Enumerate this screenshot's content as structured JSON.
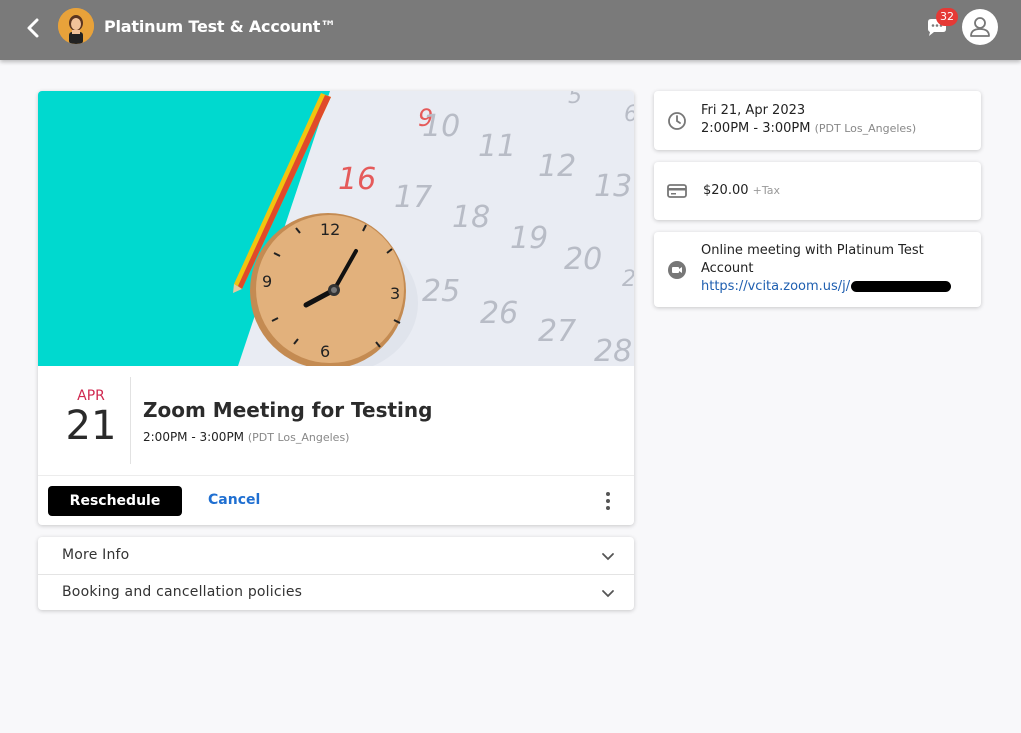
{
  "header": {
    "account_name": "Platinum Test & Account™",
    "chat_badge_count": "32",
    "icons": [
      "back-arrow-icon",
      "account-avatar",
      "chat-icon",
      "user-icon"
    ]
  },
  "event": {
    "month": "APR",
    "day": "21",
    "title": "Zoom Meeting for Testing",
    "time": "2:00PM - 3:00PM",
    "timezone": "(PDT Los_Angeles)"
  },
  "hero_image": {
    "calendar_numbers": [
      "9",
      "10",
      "11",
      "12",
      "13",
      "16",
      "17",
      "18",
      "19",
      "20",
      "25",
      "26",
      "27",
      "28",
      "5",
      "6",
      "2"
    ],
    "clock_numbers": [
      "12",
      "3",
      "6",
      "9"
    ]
  },
  "actions": {
    "reschedule_label": "Reschedule",
    "cancel_label": "Cancel"
  },
  "accordion": {
    "items": [
      {
        "label": "More Info"
      },
      {
        "label": "Booking and cancellation policies"
      }
    ]
  },
  "details": {
    "date": "Fri 21, Apr 2023",
    "time": "2:00PM - 3:00PM",
    "timezone": "(PDT Los_Angeles)",
    "price": "$20.00",
    "tax": "+Tax",
    "meeting_line1": "Online meeting with Platinum Test Account",
    "meeting_link": "https://vcita.zoom.us/j/"
  },
  "colors": {
    "topbar": "#7a7a7a",
    "accent_red": "#d0284f",
    "link_blue": "#1f6fd1",
    "badge_red": "#e53935",
    "teal": "#00d9cf"
  }
}
